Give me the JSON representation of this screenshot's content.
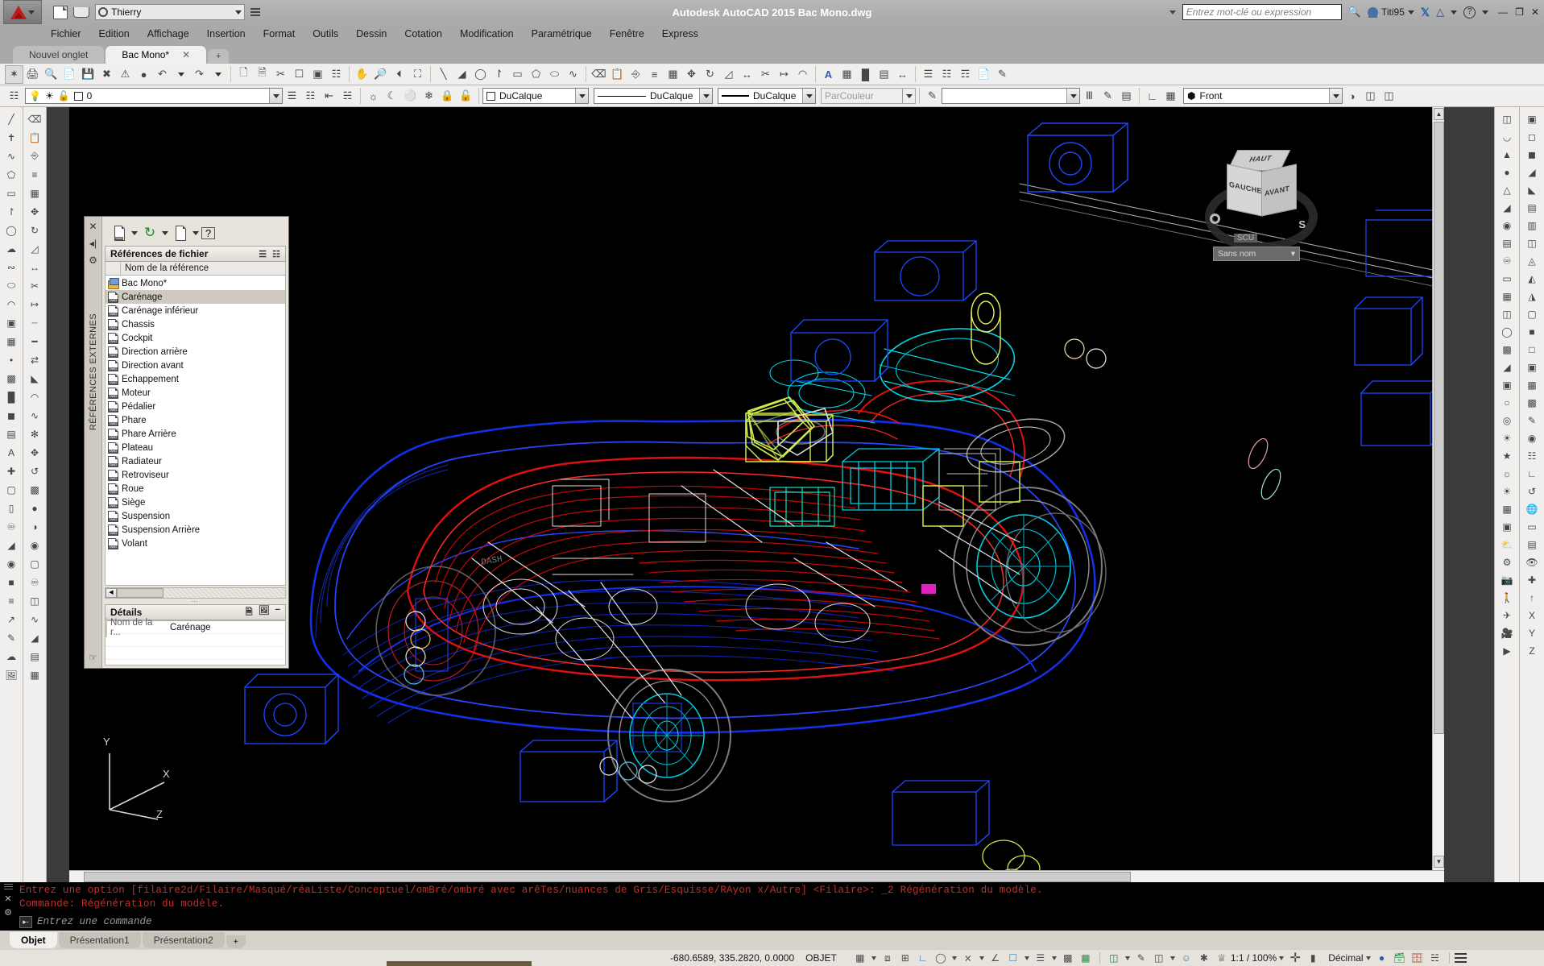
{
  "titlebar": {
    "app_title": "Autodesk AutoCAD 2015   Bac Mono.dwg",
    "workspace": "Thierry",
    "search_placeholder": "Entrez mot-clé ou expression",
    "user_name": "Titi95",
    "icons": {
      "new": "new-document-icon",
      "open": "open-folder-icon",
      "gear": "workspace-gear-icon",
      "binoculars": "search-binoculars-icon",
      "exchange": "autodesk-exchange-icon",
      "help": "help-icon"
    },
    "window_buttons": [
      "minimize",
      "restore",
      "close"
    ]
  },
  "menubar": {
    "items": [
      "Fichier",
      "Edition",
      "Affichage",
      "Insertion",
      "Format",
      "Outils",
      "Dessin",
      "Cotation",
      "Modification",
      "Paramétrique",
      "Fenêtre",
      "Express"
    ]
  },
  "filetabs": {
    "tabs": [
      {
        "label": "Nouvel onglet",
        "active": false,
        "closable": false
      },
      {
        "label": "Bac Mono*",
        "active": true,
        "closable": true
      }
    ],
    "add_label": "+"
  },
  "properties_toolbar": {
    "layer_value": "0",
    "color_value": "DuCalque",
    "linetype_value": "DuCalque",
    "lineweight_value": "DuCalque",
    "plotstyle_value": "ParCouleur",
    "textstyle_value": "",
    "view_value": "Front"
  },
  "xref_palette": {
    "panel_title": "RÉFÉRENCES EXTERNES",
    "section_title": "Références de fichier",
    "column_header": "Nom de la référence",
    "items": [
      {
        "name": "Bac Mono*",
        "type": "host",
        "selected": false
      },
      {
        "name": "Carénage",
        "type": "dwg",
        "selected": true
      },
      {
        "name": "Carénage inférieur",
        "type": "dwg",
        "selected": false
      },
      {
        "name": "Chassis",
        "type": "dwg",
        "selected": false
      },
      {
        "name": "Cockpit",
        "type": "dwg",
        "selected": false
      },
      {
        "name": "Direction arrière",
        "type": "dwg",
        "selected": false
      },
      {
        "name": "Direction avant",
        "type": "dwg",
        "selected": false
      },
      {
        "name": "Echappement",
        "type": "dwg",
        "selected": false
      },
      {
        "name": "Moteur",
        "type": "dwg",
        "selected": false
      },
      {
        "name": "Pédalier",
        "type": "dwg",
        "selected": false
      },
      {
        "name": "Phare",
        "type": "dwg",
        "selected": false
      },
      {
        "name": "Phare Arrière",
        "type": "dwg",
        "selected": false
      },
      {
        "name": "Plateau",
        "type": "dwg",
        "selected": false
      },
      {
        "name": "Radiateur",
        "type": "dwg",
        "selected": false
      },
      {
        "name": "Retroviseur",
        "type": "dwg",
        "selected": false
      },
      {
        "name": "Roue",
        "type": "dwg",
        "selected": false
      },
      {
        "name": "Siège",
        "type": "dwg",
        "selected": false
      },
      {
        "name": "Suspension",
        "type": "dwg",
        "selected": false
      },
      {
        "name": "Suspension Arrière",
        "type": "dwg",
        "selected": false
      },
      {
        "name": "Volant",
        "type": "dwg",
        "selected": false
      }
    ],
    "details": {
      "title": "Détails",
      "key": "Nom de la r...",
      "value": "Carénage"
    },
    "toolbar_icons": [
      "attach-dwg-icon",
      "refresh-icon",
      "bind-xref-icon",
      "help-icon"
    ],
    "view_icons": [
      "list-view-icon",
      "tree-view-icon"
    ]
  },
  "viewcube": {
    "face_top": "HAUT",
    "face_left": "GAUCHE",
    "face_front": "AVANT",
    "compass_w": "O",
    "compass_s": "S",
    "ucs_label": "SCU",
    "ucs_value": "Sans nom"
  },
  "ucs_icon": {
    "x": "X",
    "y": "Y",
    "z": "Z"
  },
  "command_line": {
    "history": [
      "Entrez une option [filaire2d/Filaire/Masqué/réaListe/Conceptuel/omBré/ombré avec arêTes/nuances de Gris/Esquisse/RAyon x/Autre] <Filaire>: _2 Régénération du modèle.",
      "Commande:  Régénération du modèle."
    ],
    "placeholder": "Entrez une commande"
  },
  "statusbar": {
    "layout_tabs": [
      {
        "label": "Objet",
        "active": true
      },
      {
        "label": "Présentation1",
        "active": false
      },
      {
        "label": "Présentation2",
        "active": false
      }
    ],
    "add_layout": "+",
    "coordinates": "-680.6589, 335.2820, 0.0000",
    "space_label": "OBJET",
    "scale": "1:1 / 100%",
    "units": "Décimal",
    "toggle_icons": [
      "grid-display-icon",
      "snap-mode-icon",
      "infer-constraints-icon",
      "ortho-mode-icon",
      "polar-tracking-icon",
      "object-snap-icon",
      "object-snap-tracking-icon",
      "dynamic-ucs-icon",
      "dynamic-input-icon",
      "lineweight-icon",
      "transparency-icon"
    ],
    "right_icons": [
      "workspace-switch-icon",
      "annotation-visibility-icon",
      "viewport-icon",
      "annotation-scale-icon",
      "isolate-objects-icon",
      "hardware-accel-icon",
      "clean-screen-icon",
      "customization-icon"
    ]
  }
}
